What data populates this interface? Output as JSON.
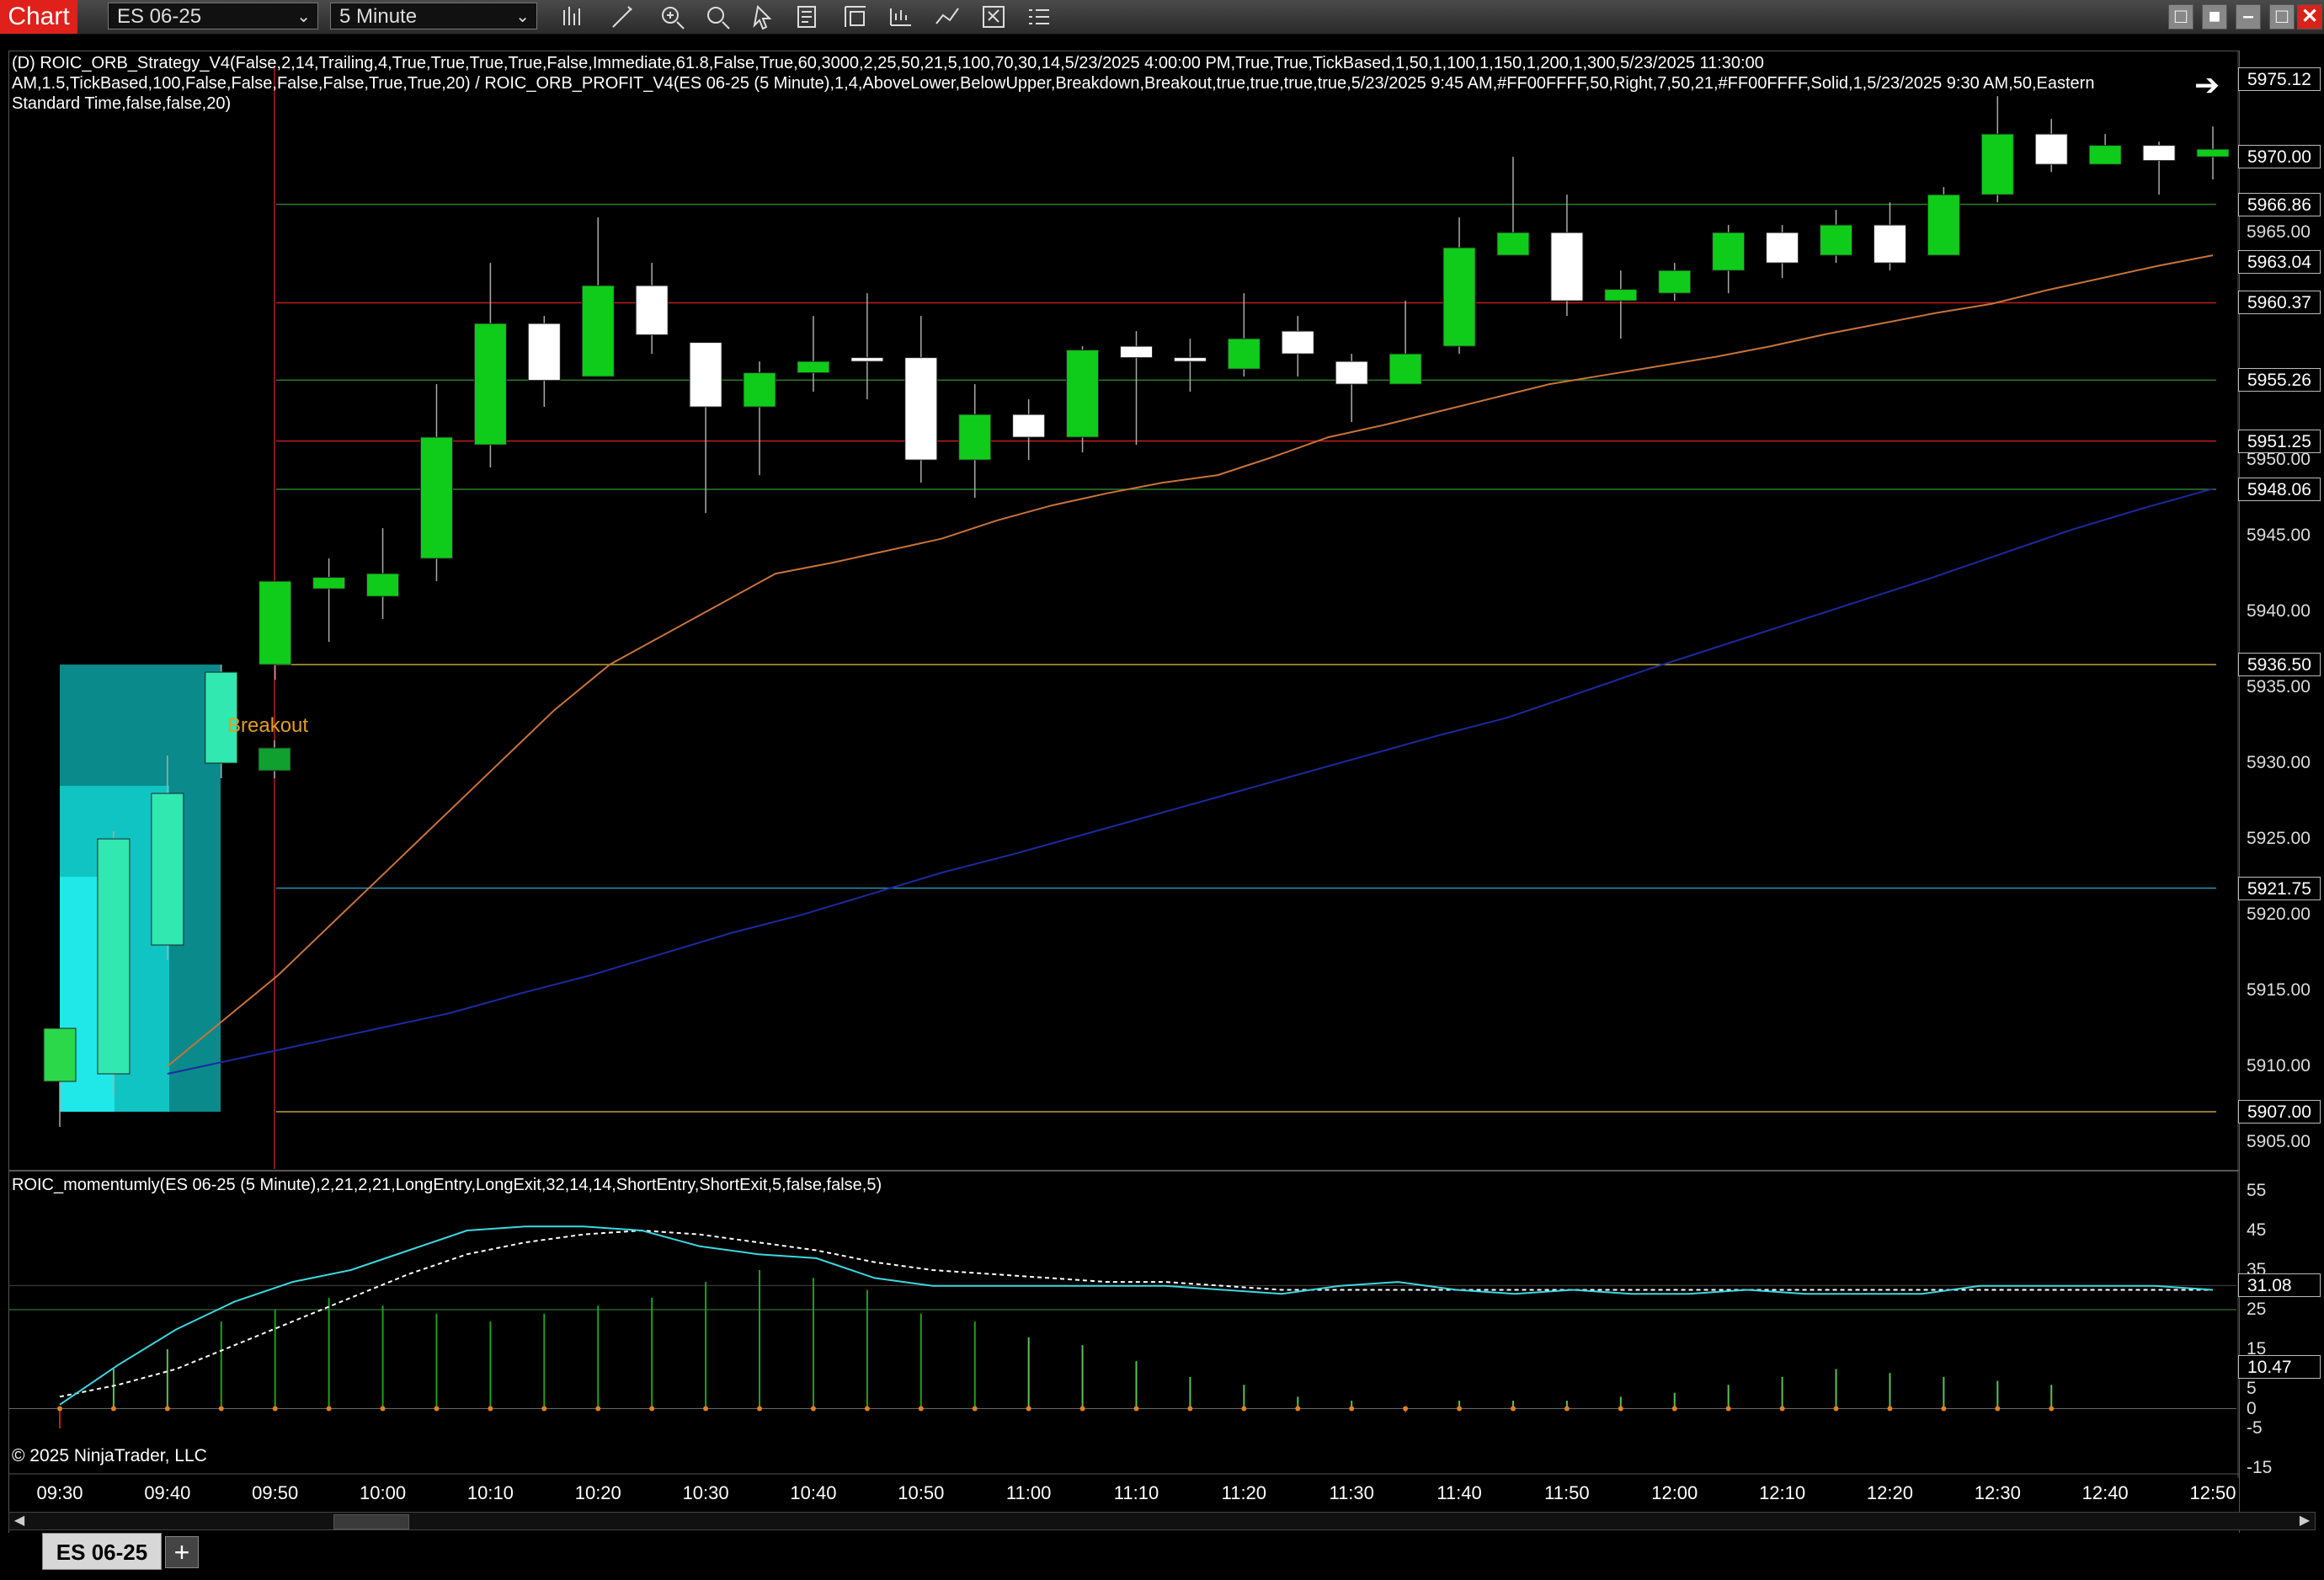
{
  "app": {
    "badge": "Chart"
  },
  "toolbar": {
    "instrument": "ES 06-25",
    "interval": "5 Minute",
    "icons": [
      "bars-icon",
      "draw-icon",
      "zoom-in-icon",
      "zoom-out-icon",
      "pointer-icon",
      "properties-icon",
      "templates-icon",
      "data-box-icon",
      "indicators-icon",
      "strategies-icon",
      "more-icon"
    ]
  },
  "strategy_label": {
    "line1": "(D) ROIC_ORB_Strategy_V4(False,2,14,Trailing,4,True,True,True,True,False,Immediate,61.8,False,True,60,3000,2,25,50,21,5,100,70,30,14,5/23/2025 4:00:00 PM,True,True,TickBased,1,50,1,100,1,150,1,200,1,300,5/23/2025 11:30:00",
    "line2": "AM,1.5,TickBased,100,False,False,False,False,True,True,20) / ROIC_ORB_PROFIT_V4(ES 06-25 (5 Minute),1,4,AboveLower,BelowUpper,Breakdown,Breakout,true,true,true,true,5/23/2025 9:45 AM,#FF00FFFF,50,Right,7,50,21,#FF00FFFF,Solid,1,5/23/2025 9:30 AM,50,Eastern",
    "line3": "Standard Time,false,false,20)"
  },
  "breakout_label": "Breakout",
  "momentum_label": "ROIC_momentumly(ES 06-25 (5 Minute),2,21,2,21,LongEntry,LongExit,32,14,14,ShortEntry,ShortExit,5,false,false,5)",
  "copyright": "© 2025 NinjaTrader, LLC",
  "price_axis": {
    "plain": [
      "5965.00",
      "5950.00",
      "5945.00",
      "5940.00",
      "5935.00",
      "5930.00",
      "5925.00",
      "5920.00",
      "5915.00",
      "5910.00",
      "5905.00"
    ],
    "boxed": [
      "5975.12",
      "5970.00",
      "5966.86",
      "5963.04",
      "5960.37",
      "5955.26",
      "5951.25",
      "5948.06",
      "5936.50",
      "5921.75",
      "5907.00"
    ]
  },
  "momentum_axis": {
    "plain": [
      "55",
      "45",
      "35",
      "25",
      "15",
      "5",
      "0",
      "-5",
      "-15"
    ],
    "boxed": [
      "31.08",
      "10.47"
    ]
  },
  "time_axis": [
    "09:30",
    "09:40",
    "09:50",
    "10:00",
    "10:10",
    "10:20",
    "10:30",
    "10:40",
    "10:50",
    "11:00",
    "11:10",
    "11:20",
    "11:30",
    "11:40",
    "11:50",
    "12:00",
    "12:10",
    "12:20",
    "12:30",
    "12:40",
    "12:50"
  ],
  "tabs": {
    "active": "ES 06-25",
    "add": "+"
  },
  "chart_data": {
    "type": "candlestick",
    "instrument": "ES 06-25",
    "interval": "5 Minute",
    "ylim": [
      5903,
      5978
    ],
    "candles": [
      {
        "t": "09:30",
        "o": 5909.0,
        "h": 5912.5,
        "l": 5906.0,
        "c": 5912.5
      },
      {
        "t": "09:35",
        "o": 5909.5,
        "h": 5925.5,
        "l": 5908.0,
        "c": 5925.0
      },
      {
        "t": "09:40",
        "o": 5918.0,
        "h": 5930.5,
        "l": 5917.0,
        "c": 5928.0
      },
      {
        "t": "09:45",
        "o": 5930.0,
        "h": 5936.5,
        "l": 5929.0,
        "c": 5936.0
      },
      {
        "t": "09:50",
        "o": 5931.0,
        "h": 5931.5,
        "l": 5929.0,
        "c": 5929.5
      },
      {
        "t": "09:50",
        "o": 5936.5,
        "h": 5942.0,
        "l": 5935.5,
        "c": 5942.0
      },
      {
        "t": "09:55",
        "o": 5941.5,
        "h": 5943.5,
        "l": 5938.0,
        "c": 5942.25
      },
      {
        "t": "10:00",
        "o": 5941.0,
        "h": 5945.5,
        "l": 5939.5,
        "c": 5942.5
      },
      {
        "t": "10:05",
        "o": 5943.5,
        "h": 5955.0,
        "l": 5942.0,
        "c": 5951.5
      },
      {
        "t": "10:10",
        "o": 5951.0,
        "h": 5963.0,
        "l": 5949.5,
        "c": 5959.0
      },
      {
        "t": "10:15",
        "o": 5959.0,
        "h": 5959.5,
        "l": 5953.5,
        "c": 5955.25
      },
      {
        "t": "10:20",
        "o": 5955.5,
        "h": 5966.0,
        "l": 5955.5,
        "c": 5961.5
      },
      {
        "t": "10:25",
        "o": 5961.5,
        "h": 5963.0,
        "l": 5957.0,
        "c": 5958.25
      },
      {
        "t": "10:30",
        "o": 5957.75,
        "h": 5957.75,
        "l": 5946.5,
        "c": 5953.5
      },
      {
        "t": "10:35",
        "o": 5953.5,
        "h": 5956.5,
        "l": 5949.0,
        "c": 5955.75
      },
      {
        "t": "10:40",
        "o": 5955.75,
        "h": 5959.5,
        "l": 5954.5,
        "c": 5956.5
      },
      {
        "t": "10:45",
        "o": 5956.75,
        "h": 5961.0,
        "l": 5954.0,
        "c": 5956.5
      },
      {
        "t": "10:50",
        "o": 5956.75,
        "h": 5959.5,
        "l": 5948.5,
        "c": 5950.0
      },
      {
        "t": "10:55",
        "o": 5950.0,
        "h": 5955.0,
        "l": 5947.5,
        "c": 5953.0
      },
      {
        "t": "11:00",
        "o": 5953.0,
        "h": 5954.0,
        "l": 5950.0,
        "c": 5951.5
      },
      {
        "t": "11:05",
        "o": 5951.5,
        "h": 5957.5,
        "l": 5950.5,
        "c": 5957.25
      },
      {
        "t": "11:10",
        "o": 5957.5,
        "h": 5958.5,
        "l": 5951.0,
        "c": 5956.75
      },
      {
        "t": "11:15",
        "o": 5956.75,
        "h": 5958.0,
        "l": 5954.5,
        "c": 5956.5
      },
      {
        "t": "11:20",
        "o": 5956.0,
        "h": 5961.0,
        "l": 5955.5,
        "c": 5958.0
      },
      {
        "t": "11:25",
        "o": 5958.5,
        "h": 5959.5,
        "l": 5955.5,
        "c": 5957.0
      },
      {
        "t": "11:30",
        "o": 5956.5,
        "h": 5957.0,
        "l": 5952.5,
        "c": 5955.0
      },
      {
        "t": "11:35",
        "o": 5955.0,
        "h": 5960.5,
        "l": 5955.0,
        "c": 5957.0
      },
      {
        "t": "11:40",
        "o": 5957.5,
        "h": 5966.0,
        "l": 5957.0,
        "c": 5964.0
      },
      {
        "t": "11:45",
        "o": 5963.5,
        "h": 5970.0,
        "l": 5963.5,
        "c": 5965.0
      },
      {
        "t": "11:50",
        "o": 5965.0,
        "h": 5967.5,
        "l": 5959.5,
        "c": 5960.5
      },
      {
        "t": "11:55",
        "o": 5960.5,
        "h": 5962.5,
        "l": 5958.0,
        "c": 5961.25
      },
      {
        "t": "12:00",
        "o": 5961.0,
        "h": 5963.0,
        "l": 5960.5,
        "c": 5962.5
      },
      {
        "t": "12:05",
        "o": 5962.5,
        "h": 5965.5,
        "l": 5961.0,
        "c": 5965.0
      },
      {
        "t": "12:10",
        "o": 5965.0,
        "h": 5965.5,
        "l": 5962.0,
        "c": 5963.0
      },
      {
        "t": "12:15",
        "o": 5963.5,
        "h": 5966.5,
        "l": 5963.0,
        "c": 5965.5
      },
      {
        "t": "12:20",
        "o": 5965.5,
        "h": 5967.0,
        "l": 5962.5,
        "c": 5963.0
      },
      {
        "t": "12:25",
        "o": 5963.5,
        "h": 5968.0,
        "l": 5963.5,
        "c": 5967.5
      },
      {
        "t": "12:30",
        "o": 5967.5,
        "h": 5974.0,
        "l": 5967.0,
        "c": 5971.5
      },
      {
        "t": "12:35",
        "o": 5971.5,
        "h": 5972.5,
        "l": 5969.0,
        "c": 5969.5
      },
      {
        "t": "12:40",
        "o": 5969.5,
        "h": 5971.5,
        "l": 5969.5,
        "c": 5970.75
      },
      {
        "t": "12:45",
        "o": 5970.75,
        "h": 5971.0,
        "l": 5967.5,
        "c": 5969.75
      },
      {
        "t": "12:50",
        "o": 5970.0,
        "h": 5972.0,
        "l": 5968.5,
        "c": 5970.5
      }
    ],
    "levels": [
      {
        "price": 5966.86,
        "color": "#2e7d2e"
      },
      {
        "price": 5960.37,
        "color": "#c01c1c"
      },
      {
        "price": 5955.26,
        "color": "#2e7d2e"
      },
      {
        "price": 5951.25,
        "color": "#c01c1c"
      },
      {
        "price": 5948.06,
        "color": "#2e7d2e"
      },
      {
        "price": 5936.5,
        "color": "#b8a43c"
      },
      {
        "price": 5921.75,
        "color": "#2a8fb0"
      },
      {
        "price": 5907.0,
        "color": "#b8a43c"
      }
    ],
    "ma_fast": [
      5910,
      5913,
      5916,
      5919.5,
      5923,
      5926.5,
      5930,
      5933.5,
      5936.5,
      5938.5,
      5940.5,
      5942.5,
      5943.2,
      5944,
      5944.8,
      5946,
      5947,
      5947.8,
      5948.5,
      5949,
      5950.2,
      5951.5,
      5952.3,
      5953.2,
      5954.1,
      5955,
      5955.6,
      5956.2,
      5956.8,
      5957.5,
      5958.3,
      5959,
      5959.7,
      5960.3,
      5961.2,
      5962,
      5962.8,
      5963.5
    ],
    "ma_slow": [
      5909.5,
      5910.5,
      5911.5,
      5912.5,
      5913.5,
      5914.8,
      5916,
      5917.4,
      5918.8,
      5920,
      5921.4,
      5922.8,
      5924,
      5925.3,
      5926.6,
      5927.9,
      5929.2,
      5930.5,
      5931.8,
      5933,
      5934.6,
      5936.2,
      5937.7,
      5939.2,
      5940.7,
      5942.2,
      5943.8,
      5945.4,
      5946.8,
      5948.1
    ],
    "momentum": {
      "ylim": [
        -17,
        58
      ],
      "cyan": [
        1,
        11,
        20,
        27,
        32,
        35,
        40,
        45,
        46,
        46,
        45,
        41,
        39,
        38,
        33,
        31,
        31,
        31,
        31,
        31,
        30,
        29,
        31,
        32,
        30,
        29,
        30,
        29,
        29,
        30,
        29,
        29,
        29,
        31,
        31,
        31,
        31,
        30
      ],
      "dashed": [
        3,
        6,
        10,
        16,
        22,
        28,
        34,
        39,
        42,
        44,
        45,
        44,
        42,
        40,
        37,
        35,
        34,
        33,
        32,
        32,
        31,
        30,
        30,
        30,
        30,
        30,
        30,
        30,
        30,
        30,
        30,
        30,
        30,
        30,
        30,
        30,
        30,
        30
      ],
      "hist": [
        -5,
        10,
        15,
        22,
        25,
        28,
        26,
        24,
        22,
        24,
        26,
        28,
        32,
        35,
        33,
        30,
        24,
        22,
        18,
        16,
        12,
        8,
        6,
        3,
        2,
        -1,
        2,
        2,
        2,
        3,
        4,
        6,
        8,
        10,
        9,
        8,
        7,
        6
      ]
    }
  }
}
